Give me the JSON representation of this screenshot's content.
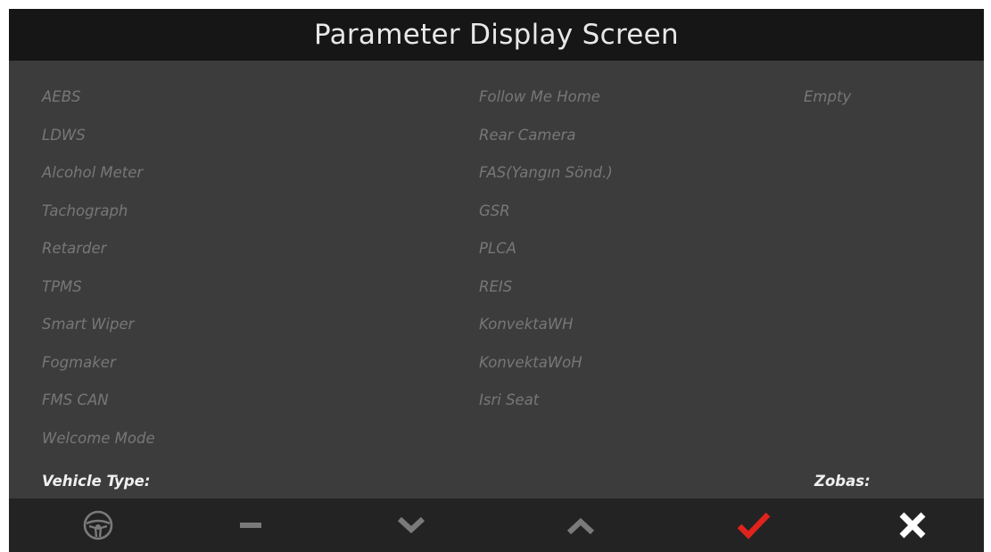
{
  "screen": {
    "title": "Parameter Display Screen"
  },
  "columns": {
    "col1": [
      "AEBS",
      "LDWS",
      "Alcohol Meter",
      "Tachograph",
      "Retarder",
      "TPMS",
      "Smart Wiper",
      "Fogmaker",
      "FMS CAN",
      "Welcome Mode"
    ],
    "col2": [
      "Follow Me Home",
      "Rear Camera",
      "FAS(Yangın Sönd.)",
      "GSR",
      "PLCA",
      "REIS",
      "KonvektaWH",
      "KonvektaWoH",
      "Isri Seat"
    ],
    "col3": [
      "Empty"
    ]
  },
  "footer": {
    "vehicle_type_label": "Vehicle Type:",
    "zobas_label": "Zobas:"
  },
  "toolbar": {
    "buttons": [
      {
        "name": "steering-wheel-icon",
        "color": "#7a7a7a"
      },
      {
        "name": "minus-icon",
        "color": "#7a7a7a"
      },
      {
        "name": "chevron-down-icon",
        "color": "#7a7a7a"
      },
      {
        "name": "chevron-up-icon",
        "color": "#7a7a7a"
      },
      {
        "name": "checkmark-icon",
        "color": "#e0231c"
      },
      {
        "name": "close-icon",
        "color": "#ffffff"
      }
    ]
  }
}
